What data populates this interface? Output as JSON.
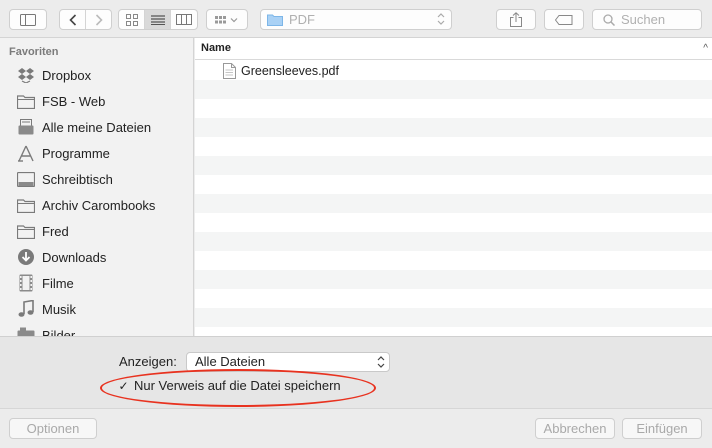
{
  "toolbar": {
    "location": {
      "label": "PDF",
      "icon": "folder-icon"
    },
    "search": {
      "placeholder": "Suchen"
    },
    "view_modes": [
      "icon-view-icon",
      "list-view-icon",
      "column-view-icon"
    ],
    "active_view": "list-view-icon",
    "icons": [
      "sidebar-toggle-icon",
      "back-icon",
      "forward-icon",
      "arrange-icon",
      "share-icon",
      "tag-icon",
      "search-icon"
    ]
  },
  "sidebar": {
    "header": "Favoriten",
    "items": [
      {
        "label": "Dropbox",
        "icon": "dropbox-icon"
      },
      {
        "label": "FSB - Web",
        "icon": "folder-icon"
      },
      {
        "label": "Alle meine Dateien",
        "icon": "all-files-icon"
      },
      {
        "label": "Programme",
        "icon": "applications-icon"
      },
      {
        "label": "Schreibtisch",
        "icon": "desktop-icon"
      },
      {
        "label": "Archiv Carombooks",
        "icon": "folder-icon"
      },
      {
        "label": "Fred",
        "icon": "folder-icon"
      },
      {
        "label": "Downloads",
        "icon": "downloads-icon"
      },
      {
        "label": "Filme",
        "icon": "movies-icon"
      },
      {
        "label": "Musik",
        "icon": "music-icon"
      },
      {
        "label": "Bilder",
        "icon": "pictures-icon"
      }
    ]
  },
  "file_list": {
    "column_name": "Name",
    "sort_indicator": "^",
    "files": [
      {
        "name": "Greensleeves.pdf",
        "icon": "pdf-file-icon"
      }
    ]
  },
  "accessory": {
    "show_label": "Anzeigen:",
    "show_value": "Alle Dateien",
    "checkbox_checked": true,
    "checkbox_mark": "✓",
    "checkbox_label": "Nur Verweis auf die Datei speichern",
    "highlight_color": "#e8321f"
  },
  "buttons": {
    "options": "Optionen",
    "cancel": "Abbrechen",
    "insert": "Einfügen"
  }
}
